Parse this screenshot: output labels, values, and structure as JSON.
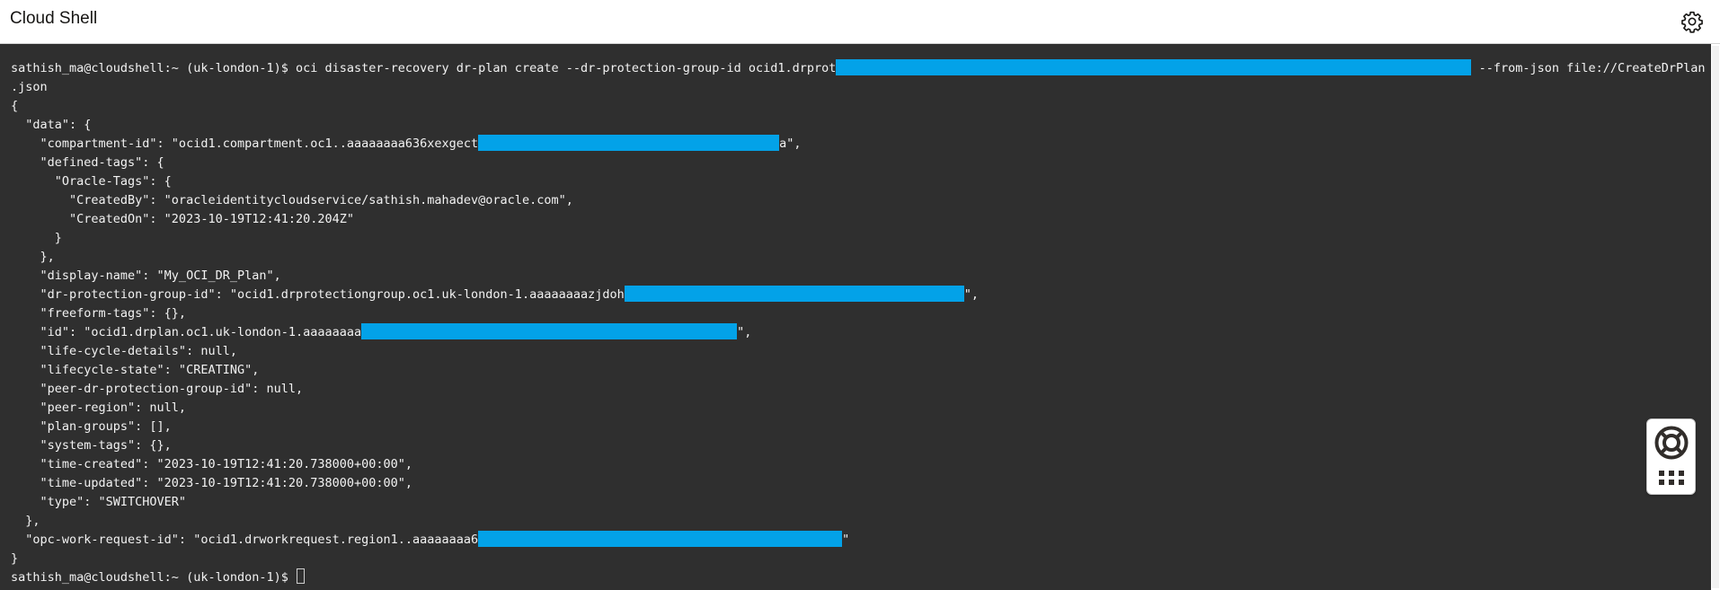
{
  "window": {
    "title": "Cloud Shell"
  },
  "icons": {
    "settings": "gear-icon",
    "help": "lifebuoy-icon",
    "apps": "grid-icon"
  },
  "colors": {
    "terminal_bg": "#2f2f2f",
    "terminal_text": "#f2f2f2",
    "redaction": "#03a2e8",
    "titlebar_bg": "#ffffff"
  },
  "terminal": {
    "lines": [
      {
        "before": "sathish_ma@cloudshell:~ (uk-london-1)$ oci disaster-recovery dr-plan create --dr-protection-group-id ocid1.drprot",
        "after": " --from-json file://CreateDrPlan"
      },
      {
        "before": ".json"
      },
      {
        "before": "{"
      },
      {
        "before": "  \"data\": {"
      },
      {
        "before": "    \"compartment-id\": \"ocid1.compartment.oc1..aaaaaaaa636xexgect",
        "after": "a\","
      },
      {
        "before": "    \"defined-tags\": {"
      },
      {
        "before": "      \"Oracle-Tags\": {"
      },
      {
        "before": "        \"CreatedBy\": \"oracleidentitycloudservice/sathish.mahadev@oracle.com\","
      },
      {
        "before": "        \"CreatedOn\": \"2023-10-19T12:41:20.204Z\""
      },
      {
        "before": "      }"
      },
      {
        "before": "    },"
      },
      {
        "before": "    \"display-name\": \"My_OCI_DR_Plan\","
      },
      {
        "before": "    \"dr-protection-group-id\": \"ocid1.drprotectiongroup.oc1.uk-london-1.aaaaaaaazjdoh",
        "after": "\","
      },
      {
        "before": "    \"freeform-tags\": {},"
      },
      {
        "before": "    \"id\": \"ocid1.drplan.oc1.uk-london-1.aaaaaaaa",
        "after": "\","
      },
      {
        "before": "    \"life-cycle-details\": null,"
      },
      {
        "before": "    \"lifecycle-state\": \"CREATING\","
      },
      {
        "before": "    \"peer-dr-protection-group-id\": null,"
      },
      {
        "before": "    \"peer-region\": null,"
      },
      {
        "before": "    \"plan-groups\": [],"
      },
      {
        "before": "    \"system-tags\": {},"
      },
      {
        "before": "    \"time-created\": \"2023-10-19T12:41:20.738000+00:00\","
      },
      {
        "before": "    \"time-updated\": \"2023-10-19T12:41:20.738000+00:00\","
      },
      {
        "before": "    \"type\": \"SWITCHOVER\""
      },
      {
        "before": "  },"
      },
      {
        "before": "  \"opc-work-request-id\": \"ocid1.drworkrequest.region1..aaaaaaaa6",
        "after": "\""
      },
      {
        "before": "}"
      },
      {
        "before": "sathish_ma@cloudshell:~ (uk-london-1)$ "
      }
    ]
  }
}
